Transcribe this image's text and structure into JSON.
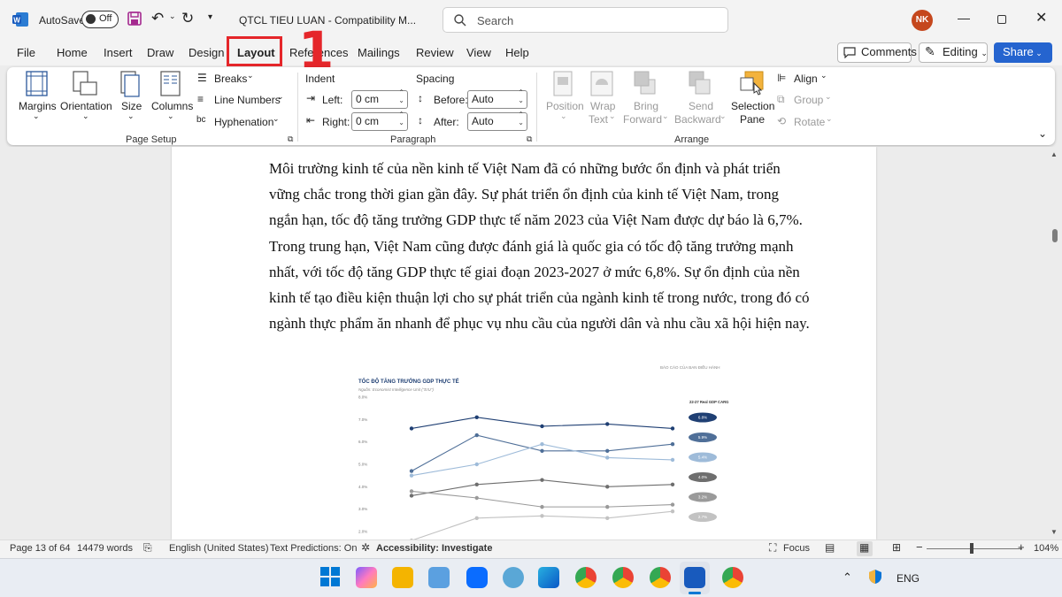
{
  "titlebar": {
    "autosave_label": "AutoSave",
    "autosave_state": "Off",
    "doc_title": "QTCL TIEU LUAN  -  Compatibility M...",
    "search_placeholder": "Search",
    "user_initials": "NK"
  },
  "tabs": [
    "File",
    "Home",
    "Insert",
    "Draw",
    "Design",
    "Layout",
    "References",
    "Mailings",
    "Review",
    "View",
    "Help"
  ],
  "active_tab": "Layout",
  "annotation": {
    "marker": "1"
  },
  "header_buttons": {
    "comments": "Comments",
    "editing": "Editing",
    "share": "Share"
  },
  "ribbon": {
    "page_setup": {
      "label": "Page Setup",
      "margins": "Margins",
      "orientation": "Orientation",
      "size": "Size",
      "columns": "Columns",
      "breaks": "Breaks",
      "line_numbers": "Line Numbers",
      "hyphenation": "Hyphenation"
    },
    "paragraph": {
      "label": "Paragraph",
      "indent": "Indent",
      "spacing": "Spacing",
      "left_label": "Left:",
      "left_value": "0 cm",
      "right_label": "Right:",
      "right_value": "0 cm",
      "before_label": "Before:",
      "before_value": "Auto",
      "after_label": "After:",
      "after_value": "Auto"
    },
    "arrange": {
      "label": "Arrange",
      "position": "Position",
      "wrap_text_1": "Wrap",
      "wrap_text_2": "Text",
      "bring_forward_1": "Bring",
      "bring_forward_2": "Forward",
      "send_backward_1": "Send",
      "send_backward_2": "Backward",
      "selection_pane_1": "Selection",
      "selection_pane_2": "Pane",
      "align": "Align",
      "group": "Group",
      "rotate": "Rotate"
    }
  },
  "document": {
    "paragraph_lines": [
      "Môi trường kinh tế của nền kinh tế Việt Nam đã có những bước ổn định và phát triển",
      "vững chắc trong thời gian gần đây. Sự phát triển ổn định của kinh tế Việt Nam, trong",
      "ngắn hạn, tốc độ tăng trưởng GDP thực tế năm 2023 của Việt Nam được dự báo là 6,7%.",
      "Trong trung hạn, Việt Nam cũng được đánh giá là quốc gia có tốc độ tăng trưởng mạnh",
      "nhất, với tốc độ tăng GDP thực tế giai đoạn 2023-2027 ở mức 6,8%. Sự ổn định của nền",
      "kinh tế tạo điều kiện thuận lợi cho sự phát triển của ngành kinh tế trong nước, trong đó có",
      "ngành thực phẩm ăn nhanh để phục vụ nhu cầu của người dân và nhu cầu xã hội hiện nay."
    ]
  },
  "chart_data": {
    "type": "line",
    "title": "TỐC ĐỘ TĂNG TRƯỞNG GDP THỰC TẾ",
    "subtitle": "Nguồn: Economist Intelligence Unit (\"EIU\")",
    "header_note": "BÁO CÁO CỦA BAN ĐIỀU HÀNH",
    "legend_title": "22-27 Real GDP CARG",
    "ylim": [
      2.0,
      8.0
    ],
    "yticks": [
      "8.0%",
      "7.0%",
      "6.0%",
      "5.0%",
      "4.0%",
      "3.0%",
      "2.0%"
    ],
    "x": [
      1,
      2,
      3,
      4,
      5
    ],
    "series": [
      {
        "values": [
          6.6,
          7.1,
          6.7,
          6.8,
          6.6
        ],
        "color": "#1f3f73",
        "badge": "6.8%"
      },
      {
        "values": [
          4.7,
          6.3,
          5.6,
          5.6,
          5.9
        ],
        "color": "#4f6f98",
        "badge": "5.9%"
      },
      {
        "values": [
          4.5,
          5.0,
          5.9,
          5.3,
          5.2
        ],
        "color": "#9ebbd9",
        "badge": "5.4%"
      },
      {
        "values": [
          3.6,
          4.1,
          4.3,
          4.0,
          4.1
        ],
        "color": "#6e6e6e",
        "badge": "4.0%"
      },
      {
        "values": [
          3.8,
          3.5,
          3.1,
          3.1,
          3.2
        ],
        "color": "#9a9a9a",
        "badge": "3.2%"
      },
      {
        "values": [
          1.6,
          2.6,
          2.7,
          2.6,
          2.9
        ],
        "color": "#c2c2c2",
        "badge": "2.7%"
      }
    ]
  },
  "statusbar": {
    "page": "Page 13 of 64",
    "words": "14479 words",
    "language": "English (United States)",
    "predictions": "Text Predictions: On",
    "accessibility": "Accessibility: Investigate",
    "focus": "Focus",
    "zoom": "104%"
  },
  "taskbar": {
    "language": "ENG"
  }
}
